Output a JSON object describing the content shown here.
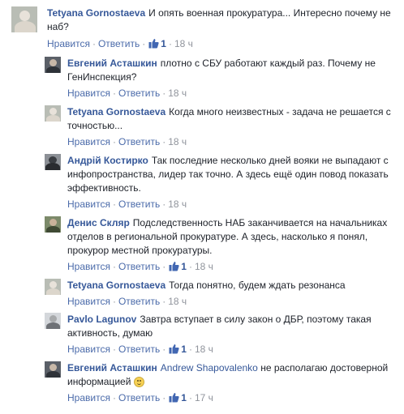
{
  "actions": {
    "like": "Нравится",
    "reply": "Ответить",
    "sep": "·"
  },
  "comments": [
    {
      "author": "Tetyana Gornostaeva",
      "text": "И опять военная прокуратура... Интересно почему не наб?",
      "likes": "1",
      "time": "18 ч"
    },
    {
      "author": "Евгений Асташкин",
      "text": "плотно с СБУ работают каждый раз. Почему не ГенИнспекция?",
      "time": "18 ч"
    },
    {
      "author": "Tetyana Gornostaeva",
      "text": "Когда много неизвестных - задача не решается с точностью...",
      "time": "18 ч"
    },
    {
      "author": "Андрій Костирко",
      "text": "Так последние несколько дней вояки не выпадают с инфопространства, лидер так точно. А здесь ещё один повод показать эффективность.",
      "time": "18 ч"
    },
    {
      "author": "Денис Скляр",
      "text": "Подследственность НАБ заканчивается на начальниках отделов в региональной прокуратуре. А здесь, насколько я понял, прокурор местной прокуратуры.",
      "likes": "1",
      "time": "18 ч"
    },
    {
      "author": "Tetyana Gornostaeva",
      "text": "Тогда понятно, будем ждать резонанса",
      "time": "18 ч"
    },
    {
      "author": "Pavlo Lagunov",
      "text": "Завтра вступает в силу закон о ДБР, поэтому такая активность, думаю",
      "likes": "1",
      "time": "18 ч"
    },
    {
      "author": "Евгений Асташкин",
      "mention": "Andrew Shapovalenko",
      "text": "не располагаю достоверной информацией",
      "emoji": "smile-emoji",
      "likes": "1",
      "time": "17 ч"
    }
  ]
}
